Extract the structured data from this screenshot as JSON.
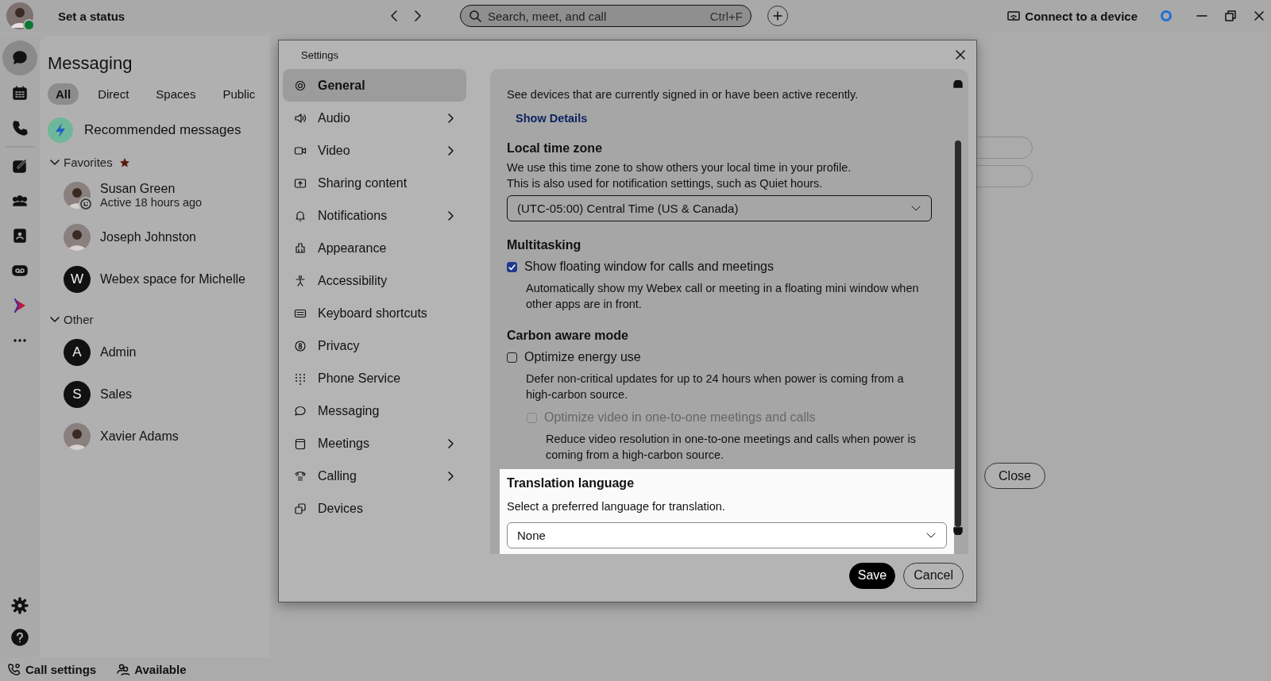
{
  "top_bar": {
    "user": {
      "available": true
    },
    "status": "Set a status",
    "search": {
      "placeholder": "Search, meet, and call",
      "shortcut": "Ctrl+F"
    },
    "connect": "Connect to a device"
  },
  "nav_rail": {
    "items": [
      {
        "selected": true
      },
      {
        "selected": false
      },
      {
        "selected": false
      },
      {
        "selected": false
      },
      {
        "selected": false
      },
      {
        "selected": false
      },
      {
        "selected": false
      },
      {
        "selected": false
      },
      {
        "selected": false
      }
    ]
  },
  "messaging": {
    "title": "Messaging",
    "filters": [
      {
        "label": "All",
        "selected": true
      },
      {
        "label": "Direct",
        "selected": false
      },
      {
        "label": "Spaces",
        "selected": false
      },
      {
        "label": "Public",
        "selected": false
      }
    ],
    "recommended": "Recommended messages",
    "sections": [
      {
        "title": "Favorites",
        "expanded": true,
        "starred": true,
        "items": [
          {
            "name": "Susan Green",
            "status": "Active 18 hours ago",
            "kind": "photo",
            "away": true
          },
          {
            "name": "Joseph Johnston",
            "kind": "photo",
            "away": false
          },
          {
            "name": "Webex space for Michelle",
            "kind": "letter",
            "initial": "W",
            "away": false
          }
        ]
      },
      {
        "title": "Other",
        "expanded": true,
        "starred": false,
        "items": [
          {
            "name": "Admin",
            "kind": "letter",
            "initial": "A",
            "away": false
          },
          {
            "name": "Sales",
            "kind": "letter",
            "initial": "S",
            "away": false
          },
          {
            "name": "Xavier Adams",
            "kind": "photo",
            "away": false
          }
        ]
      }
    ]
  },
  "footer": {
    "call_settings": "Call settings",
    "availability": "Available"
  },
  "background": {
    "close_button": "Close"
  },
  "settings": {
    "title": "Settings",
    "nav": [
      {
        "label": "General",
        "selected": true,
        "submenu": false
      },
      {
        "label": "Audio",
        "selected": false,
        "submenu": true
      },
      {
        "label": "Video",
        "selected": false,
        "submenu": true
      },
      {
        "label": "Sharing content",
        "selected": false,
        "submenu": false
      },
      {
        "label": "Notifications",
        "selected": false,
        "submenu": true
      },
      {
        "label": "Appearance",
        "selected": false,
        "submenu": false
      },
      {
        "label": "Accessibility",
        "selected": false,
        "submenu": false
      },
      {
        "label": "Keyboard shortcuts",
        "selected": false,
        "submenu": false
      },
      {
        "label": "Privacy",
        "selected": false,
        "submenu": false
      },
      {
        "label": "Phone Service",
        "selected": false,
        "submenu": false
      },
      {
        "label": "Messaging",
        "selected": false,
        "submenu": false
      },
      {
        "label": "Meetings",
        "selected": false,
        "submenu": true
      },
      {
        "label": "Calling",
        "selected": false,
        "submenu": true
      },
      {
        "label": "Devices",
        "selected": false,
        "submenu": false
      }
    ],
    "devices_note": "See devices that are currently signed in or have been active recently.",
    "show_details": "Show Details",
    "time_zone": {
      "heading": "Local time zone",
      "description": [
        "We use this time zone to show others your local time in your profile.",
        "This is also used for notification settings, such as Quiet hours."
      ],
      "value": "(UTC-05:00) Central Time (US & Canada)"
    },
    "multitasking": {
      "heading": "Multitasking",
      "options": [
        {
          "label": "Show floating window for calls and meetings",
          "checked": true,
          "disabled": false,
          "description": "Automatically show my Webex call or meeting in a floating mini window when other apps are in front."
        }
      ]
    },
    "carbon": {
      "heading": "Carbon aware mode",
      "options": [
        {
          "label": "Optimize energy use",
          "checked": false,
          "disabled": false,
          "description": "Defer non-critical updates for up to 24 hours when power is coming from a high-carbon source.",
          "children": [
            {
              "label": "Optimize video in one-to-one meetings and calls",
              "checked": false,
              "disabled": true,
              "description": "Reduce video resolution in one-to-one meetings and calls when power is coming from a high-carbon source."
            }
          ]
        }
      ]
    },
    "translation": {
      "heading": "Translation language",
      "description": "Select a preferred language for translation.",
      "value": "None",
      "highlighted": true
    },
    "buttons": [
      {
        "label": "Save",
        "kind": "primary"
      },
      {
        "label": "Cancel",
        "kind": "secondary"
      }
    ]
  }
}
